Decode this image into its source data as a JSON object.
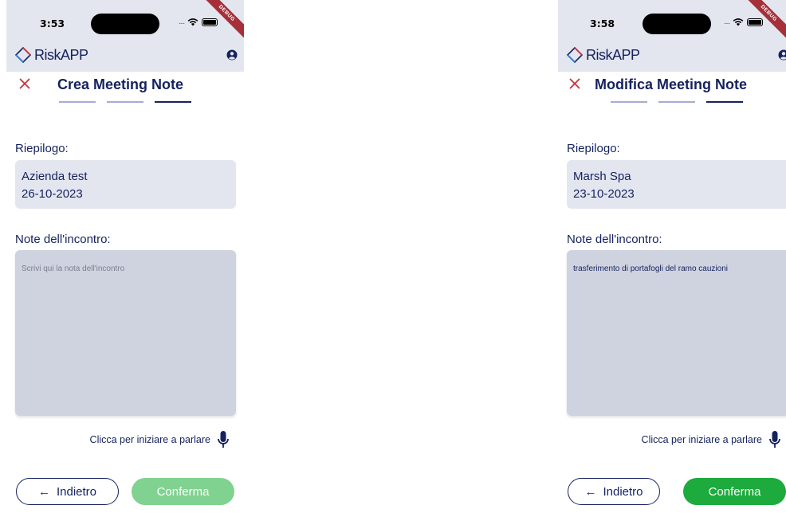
{
  "colors": {
    "header_bg": "#e3e6ef",
    "primary_navy": "#15225e",
    "close_red": "#c8323c",
    "step_inactive": "#a6abd6",
    "notes_bg": "#cfd3df",
    "confirm_disabled": "#7fd28f",
    "confirm_enabled": "#1cab3c",
    "debug_banner": "#a5303a"
  },
  "screens": [
    {
      "status": {
        "time": "3:53",
        "signal": "....",
        "banner": "DEBUG"
      },
      "app": {
        "name": "RiskAPP"
      },
      "title": "Crea Meeting Note",
      "steps": [
        {
          "active": false
        },
        {
          "active": false
        },
        {
          "active": true
        }
      ],
      "summary": {
        "label": "Riepilogo:",
        "company": "Azienda test",
        "date": "26-10-2023"
      },
      "notes": {
        "label": "Note dell'incontro:",
        "placeholder": "Scrivi qui la nota dell'incontro",
        "value": ""
      },
      "mic": {
        "text": "Clicca per iniziare a parlare"
      },
      "buttons": {
        "back": "Indietro",
        "confirm": "Conferma",
        "confirm_enabled": false
      }
    },
    {
      "status": {
        "time": "3:58",
        "signal": "....",
        "banner": "DEBUG"
      },
      "app": {
        "name": "RiskAPP"
      },
      "title": "Modifica Meeting Note",
      "steps": [
        {
          "active": false
        },
        {
          "active": false
        },
        {
          "active": true
        }
      ],
      "summary": {
        "label": "Riepilogo:",
        "company": "Marsh Spa",
        "date": "23-10-2023"
      },
      "notes": {
        "label": "Note dell'incontro:",
        "placeholder": "",
        "value": "trasferimento di portafogli del ramo cauzioni"
      },
      "mic": {
        "text": "Clicca per iniziare a parlare"
      },
      "buttons": {
        "back": "Indietro",
        "confirm": "Conferma",
        "confirm_enabled": true
      }
    }
  ]
}
